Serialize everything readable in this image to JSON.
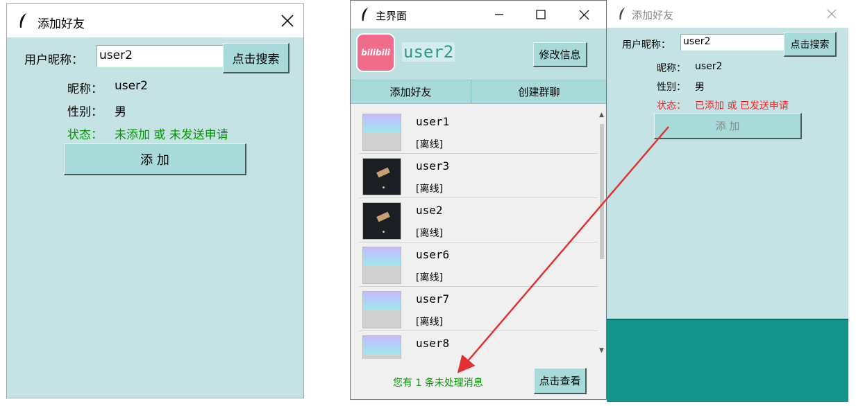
{
  "colors": {
    "window_bg": "#c5e3e4",
    "button_bg": "#a8dada",
    "status_not_added": "#009900",
    "status_added": "#ff2020",
    "notice_text": "#009900",
    "arrow": "#e03030",
    "desktop_teal": "#14948a"
  },
  "add_friend_window": {
    "title": "添加好友",
    "title_icon": "feather-icon",
    "close_icon": "close-icon",
    "search_label": "用户昵称：",
    "search_value": "user2",
    "search_button": "点击搜索",
    "nickname_label": "昵称：",
    "nickname_value": "user2",
    "gender_label": "性别：",
    "gender_value": "男",
    "status_label": "状态：",
    "status_value": "未添加 或 未发送申请",
    "add_button": "添 加"
  },
  "main_window": {
    "title": "主界面",
    "title_icon": "feather-icon",
    "minimize_icon": "minimize-icon",
    "maximize_icon": "maximize-icon",
    "close_icon": "close-icon",
    "avatar_text": "bilibili",
    "username": "user2",
    "edit_button": "修改信息",
    "tabs": [
      "添加好友",
      "创建群聊"
    ],
    "friends": [
      {
        "name": "user1",
        "status": "[离线]",
        "avatar": "gradient"
      },
      {
        "name": "user3",
        "status": "[离线]",
        "avatar": "photo"
      },
      {
        "name": "use2",
        "status": "[离线]",
        "avatar": "photo"
      },
      {
        "name": "user6",
        "status": "[离线]",
        "avatar": "gradient"
      },
      {
        "name": "user7",
        "status": "[离线]",
        "avatar": "gradient"
      },
      {
        "name": "user8",
        "status": "",
        "avatar": "gradient"
      }
    ],
    "notice": "您有 1 条未处理消息",
    "view_button": "点击查看"
  },
  "add_friend_window_2": {
    "title": "添加好友",
    "title_icon": "feather-icon",
    "close_icon": "close-icon",
    "search_label": "用户昵称：",
    "search_value": "user2",
    "search_button": "点击搜索",
    "nickname_label": "昵称：",
    "nickname_value": "user2",
    "gender_label": "性别：",
    "gender_value": "男",
    "status_label": "状态：",
    "status_value": "已添加 或 已发送申请",
    "add_button": "添 加"
  }
}
